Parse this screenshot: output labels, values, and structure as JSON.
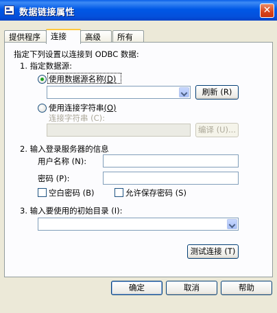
{
  "window": {
    "title": "数据链接属性",
    "close_glyph": "✕"
  },
  "tabs": [
    {
      "label": "提供程序",
      "active": false
    },
    {
      "label": "连接",
      "active": true
    },
    {
      "label": "高级",
      "active": false
    },
    {
      "label": "所有",
      "active": false
    }
  ],
  "connection": {
    "intro": "指定下列设置以连接到 ODBC 数据:",
    "step1": {
      "heading": "1. 指定数据源:",
      "radio_dsn": {
        "label": "使用数据源名称",
        "shortcut": "(D)",
        "checked": true
      },
      "dsn_combo_value": "",
      "refresh_button": "刷新 (R)",
      "radio_connstr": {
        "label": "使用连接字符串",
        "shortcut": "(O)",
        "checked": false
      },
      "connstr_label": "连接字符串 (C):",
      "connstr_value": "",
      "build_button": "编译 (U)..."
    },
    "step2": {
      "heading": "2. 输入登录服务器的信息",
      "username_label": "用户名称 (N):",
      "username_value": "",
      "password_label": "密码 (P):",
      "password_value": "",
      "blank_password": {
        "label": "空白密码 (B)",
        "checked": false
      },
      "allow_save_password": {
        "label": "允许保存密码 (S)",
        "checked": false
      }
    },
    "step3": {
      "heading": "3. 输入要使用的初始目录 (I):",
      "catalog_value": ""
    },
    "test_button": "测试连接 (T)"
  },
  "footer": {
    "ok": "确定",
    "cancel": "取消",
    "help": "帮助"
  }
}
